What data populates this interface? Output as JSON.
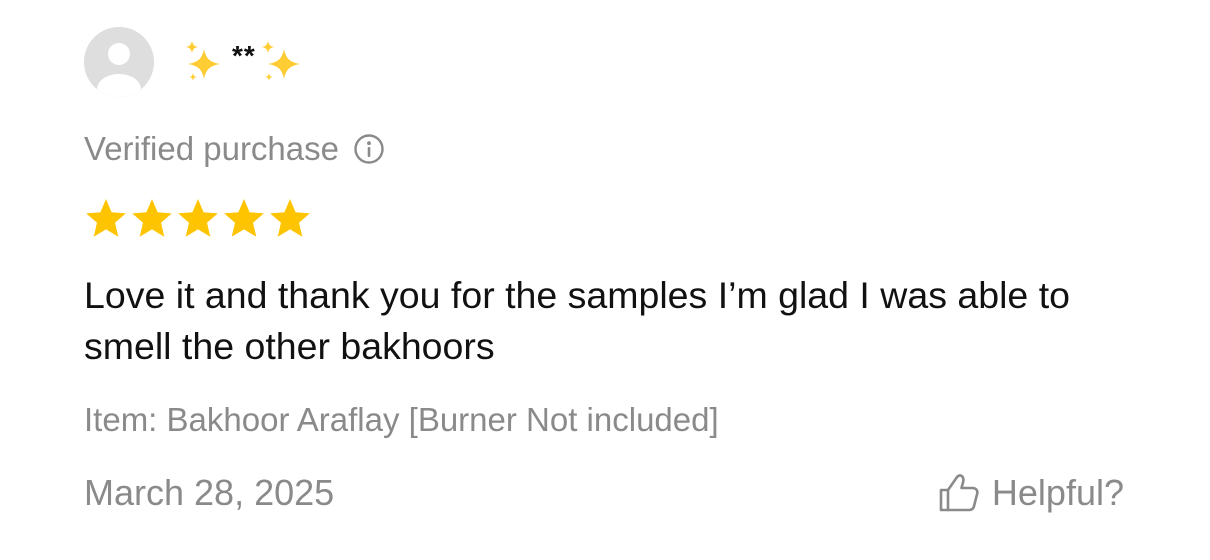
{
  "reviewer": {
    "name": "**",
    "avatar_icon": "default-user-avatar",
    "decoration_icon": "sparkles"
  },
  "verified": {
    "label": "Verified purchase",
    "icon": "info-icon"
  },
  "rating": {
    "stars": 5,
    "max": 5,
    "color": "#FFC400"
  },
  "review": {
    "text": "Love it and thank you for the samples I’m glad I was able to smell the other bakhoors"
  },
  "item": {
    "label": "Item: Bakhoor Araflay [Burner Not included]"
  },
  "footer": {
    "date": "March 28, 2025",
    "helpful_label": "Helpful?",
    "helpful_icon": "thumbs-up-icon"
  },
  "colors": {
    "text_primary": "#111111",
    "text_secondary": "#8A8A8A",
    "avatar_bg": "#DEDEDE",
    "sparkle": "#FFCC33"
  }
}
